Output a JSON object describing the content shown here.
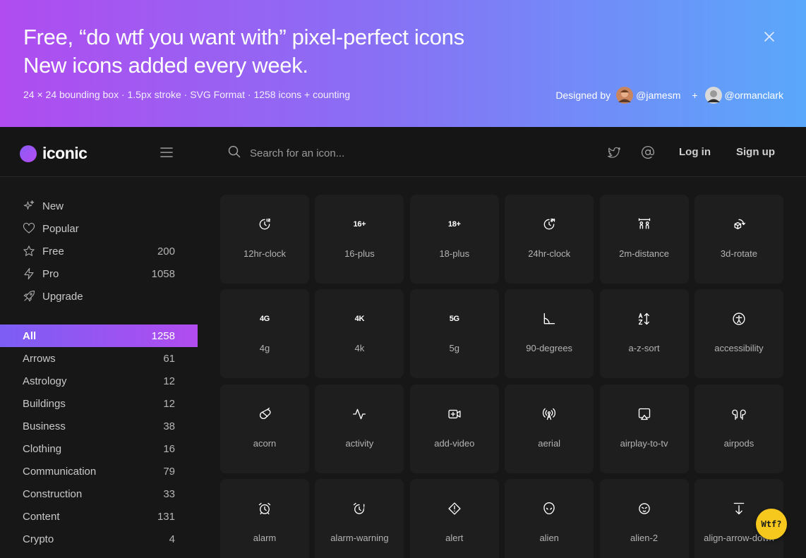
{
  "banner": {
    "title_line1": "Free, “do wtf you want with” pixel-perfect icons",
    "title_line2": "New icons added every week.",
    "specs": "24 × 24 bounding box · 1.5px stroke · SVG Format · 1258 icons + counting",
    "designed_by": "Designed by",
    "designer1": "@jamesm",
    "plus": "+",
    "designer2": "@ormanclark",
    "close_icon": "close-icon"
  },
  "topbar": {
    "logo_text": "iconic",
    "search_placeholder": "Search for an icon...",
    "login": "Log in",
    "signup": "Sign up",
    "icons": [
      "hamburger-menu-icon",
      "search-icon",
      "twitter-icon",
      "at-sign-icon"
    ]
  },
  "sidebar": {
    "nav": [
      {
        "label": "New",
        "count": "",
        "icon": "sparkles-icon"
      },
      {
        "label": "Popular",
        "count": "",
        "icon": "heart-icon"
      },
      {
        "label": "Free",
        "count": "200",
        "icon": "star-icon"
      },
      {
        "label": "Pro",
        "count": "1058",
        "icon": "lightning-icon"
      },
      {
        "label": "Upgrade",
        "count": "",
        "icon": "rocket-icon"
      }
    ],
    "categories": [
      {
        "label": "All",
        "count": "1258"
      },
      {
        "label": "Arrows",
        "count": "61"
      },
      {
        "label": "Astrology",
        "count": "12"
      },
      {
        "label": "Buildings",
        "count": "12"
      },
      {
        "label": "Business",
        "count": "38"
      },
      {
        "label": "Clothing",
        "count": "16"
      },
      {
        "label": "Communication",
        "count": "79"
      },
      {
        "label": "Construction",
        "count": "33"
      },
      {
        "label": "Content",
        "count": "131"
      },
      {
        "label": "Crypto",
        "count": "4"
      }
    ]
  },
  "icons": [
    {
      "name": "12hr-clock",
      "glyph_text": ""
    },
    {
      "name": "16-plus",
      "glyph_text": "16+"
    },
    {
      "name": "18-plus",
      "glyph_text": "18+"
    },
    {
      "name": "24hr-clock",
      "glyph_text": ""
    },
    {
      "name": "2m-distance",
      "glyph_text": ""
    },
    {
      "name": "3d-rotate",
      "glyph_text": ""
    },
    {
      "name": "4g",
      "glyph_text": "4G"
    },
    {
      "name": "4k",
      "glyph_text": "4K"
    },
    {
      "name": "5g",
      "glyph_text": "5G"
    },
    {
      "name": "90-degrees",
      "glyph_text": ""
    },
    {
      "name": "a-z-sort",
      "glyph_text": ""
    },
    {
      "name": "accessibility",
      "glyph_text": ""
    },
    {
      "name": "acorn",
      "glyph_text": ""
    },
    {
      "name": "activity",
      "glyph_text": ""
    },
    {
      "name": "add-video",
      "glyph_text": ""
    },
    {
      "name": "aerial",
      "glyph_text": ""
    },
    {
      "name": "airplay-to-tv",
      "glyph_text": ""
    },
    {
      "name": "airpods",
      "glyph_text": ""
    },
    {
      "name": "alarm",
      "glyph_text": ""
    },
    {
      "name": "alarm-warning",
      "glyph_text": ""
    },
    {
      "name": "alert",
      "glyph_text": ""
    },
    {
      "name": "alien",
      "glyph_text": ""
    },
    {
      "name": "alien-2",
      "glyph_text": ""
    },
    {
      "name": "align-arrow-down",
      "glyph_text": ""
    }
  ],
  "wtf_button": "Wtf?",
  "colors": {
    "banner_start": "#b04cf0",
    "banner_end": "#5aa8fb",
    "active_start": "#7c5ef4",
    "active_end": "#b14cf0",
    "accent_yellow": "#f6c81e"
  }
}
